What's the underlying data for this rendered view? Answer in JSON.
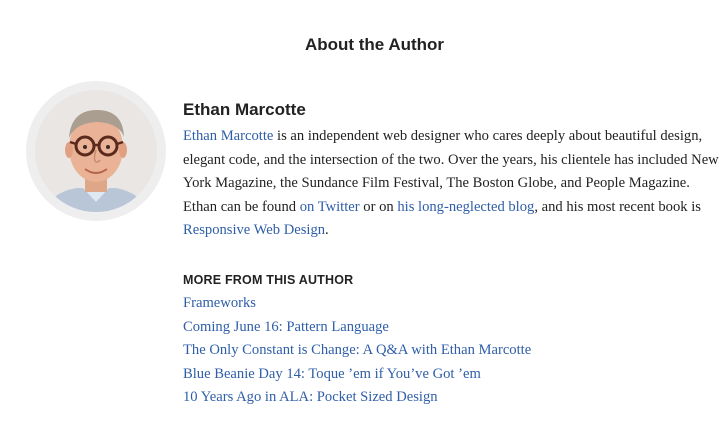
{
  "section": {
    "title": "About the Author"
  },
  "author": {
    "avatar": "author-headshot-photo",
    "name": "Ethan Marcotte",
    "bio": {
      "name_link": "Ethan Marcotte",
      "text_1": " is an independent web designer who cares deeply about beautiful design, elegant code, and the intersection of the two. Over the years, his clientele has included New York Magazine, the Sundance Film Festival, The Boston Globe, and People Magazine. Ethan can be found ",
      "twitter_link": "on Twitter",
      "text_2": " or on ",
      "blog_link": "his long-neglected blog",
      "text_3": ", and his most recent book is ",
      "book_link": "Responsive Web Design",
      "text_4": "."
    }
  },
  "more": {
    "heading": "MORE FROM THIS AUTHOR",
    "items": [
      "Frameworks",
      "Coming June 16: Pattern Language",
      "The Only Constant is Change: A Q&A with Ethan Marcotte",
      "Blue Beanie Day 14: Toque ’em if You’ve Got ’em",
      "10 Years Ago in ALA: Pocket Sized Design"
    ]
  },
  "colors": {
    "link": "#2f5ea8",
    "text": "#222222",
    "avatar_ring": "#eeeeee"
  }
}
